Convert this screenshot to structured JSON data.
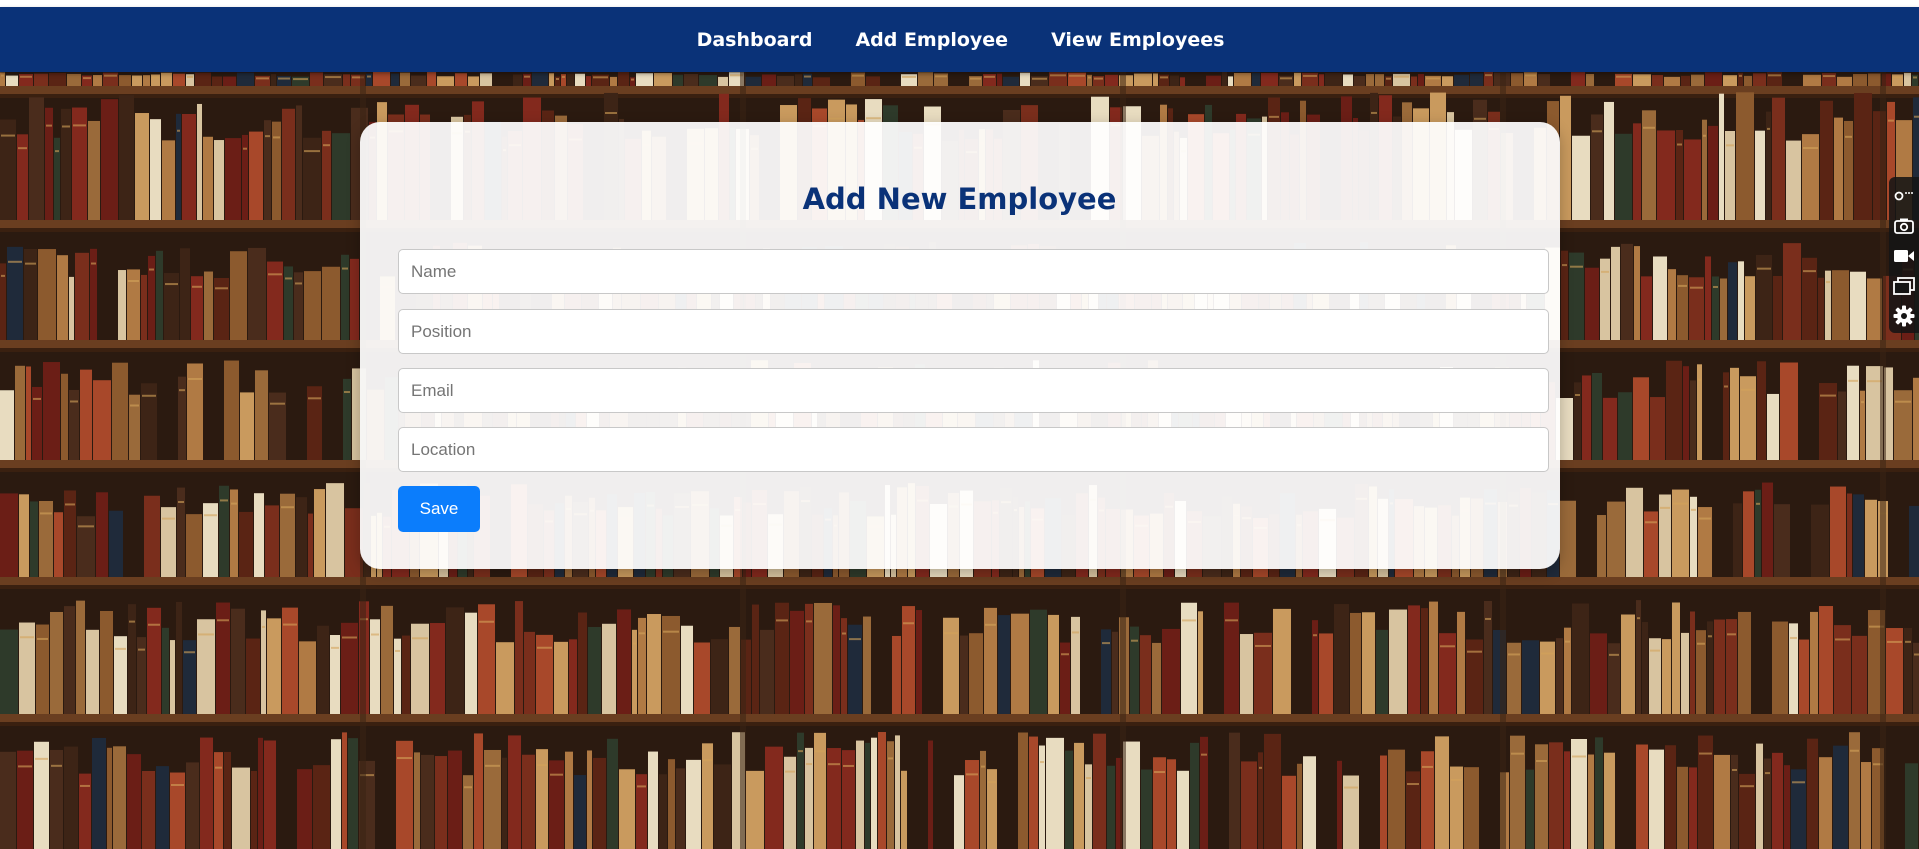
{
  "nav": {
    "links": [
      {
        "label": "Dashboard"
      },
      {
        "label": "Add Employee"
      },
      {
        "label": "View Employees"
      }
    ]
  },
  "form": {
    "title": "Add New Employee",
    "fields": [
      {
        "placeholder": "Name",
        "value": ""
      },
      {
        "placeholder": "Position",
        "value": ""
      },
      {
        "placeholder": "Email",
        "value": ""
      },
      {
        "placeholder": "Location",
        "value": ""
      }
    ],
    "save_label": "Save"
  },
  "side_toolbar": {
    "icons": [
      "link-icon",
      "camera-icon",
      "video-icon",
      "window-icon",
      "gear-icon"
    ]
  },
  "colors": {
    "navbar": "#0a3278",
    "title": "#0a3278",
    "button": "#0b7dfc"
  }
}
